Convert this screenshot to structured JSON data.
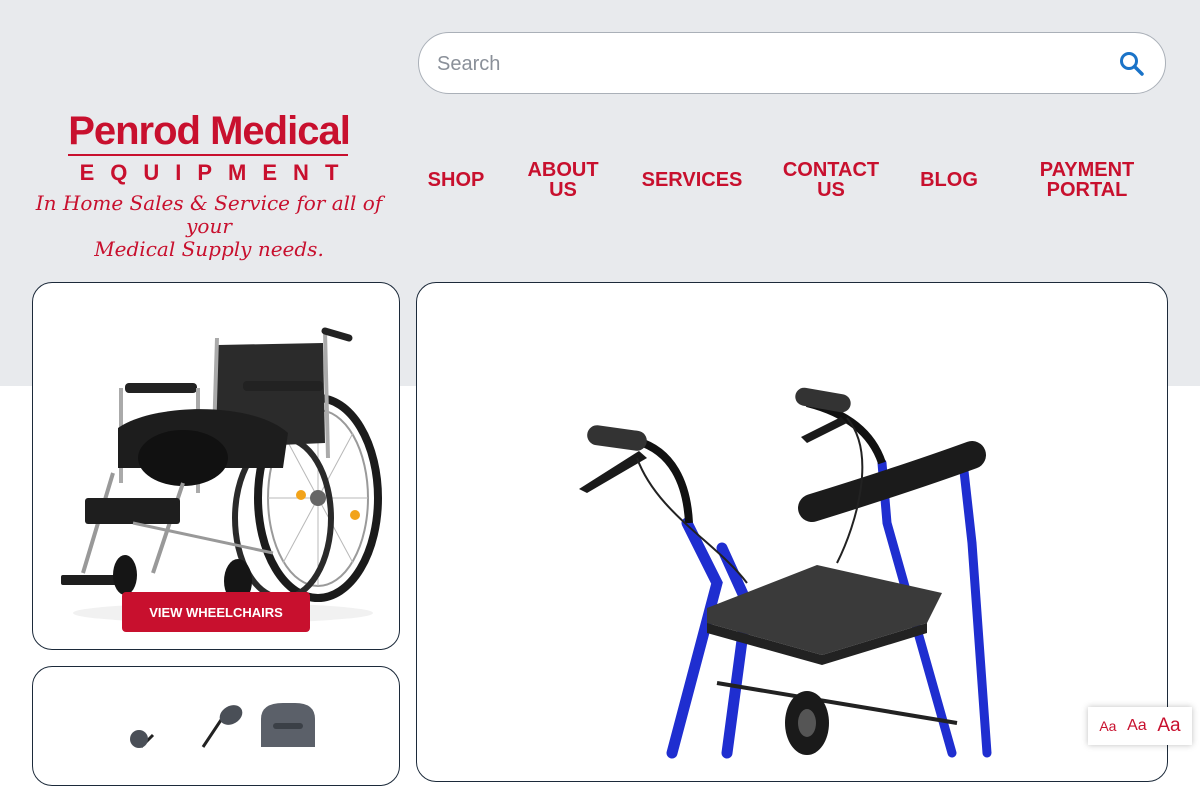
{
  "header": {
    "logo": {
      "title": "Penrod Medical",
      "subtitle": "EQUIPMENT",
      "tagline_line1": "In Home Sales & Service for all of your",
      "tagline_line2": "Medical Supply needs."
    },
    "search": {
      "placeholder": "Search"
    },
    "nav": [
      {
        "label": "SHOP"
      },
      {
        "label": "ABOUT US"
      },
      {
        "label": "SERVICES"
      },
      {
        "label": "CONTACT US"
      },
      {
        "label": "BLOG"
      },
      {
        "label": "PAYMENT PORTAL"
      }
    ]
  },
  "main": {
    "cards": [
      {
        "image": "wheelchair",
        "button_label": "VIEW WHEELCHAIRS"
      },
      {
        "image": "power-chair"
      },
      {
        "image": "rollator-walker"
      }
    ]
  },
  "accessibility": {
    "font_sizes": [
      "Aa",
      "Aa",
      "Aa"
    ]
  },
  "colors": {
    "brand": "#c8102e",
    "header_bg": "#e8eaed",
    "search_icon": "#1a73c8",
    "walker_frame": "#1f2ed0"
  }
}
